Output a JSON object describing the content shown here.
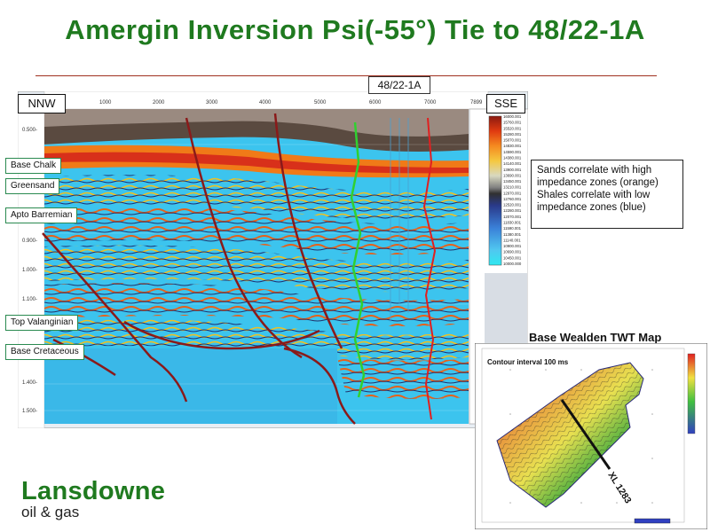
{
  "slide": {
    "title": "Amergin Inversion Psi(-55°) Tie to 48/22-1A",
    "well_label": "48/22-1A",
    "direction_left": "NNW",
    "direction_right": "SSE"
  },
  "horizon_labels": [
    "Base Chalk",
    "Greensand",
    "Apto Barremian",
    "Top Valanginian",
    "Base Cretaceous"
  ],
  "section_axis": {
    "x_ticks": [
      "1000",
      "2000",
      "3000",
      "4000",
      "5000",
      "6000",
      "7000",
      "7899"
    ],
    "y_ticks": [
      "0.500-",
      "0.900-",
      "1.000-",
      "1.100-",
      "1.400-",
      "1.500-"
    ]
  },
  "colorbar": {
    "values": [
      "16000.001",
      "15760.001",
      "15520.001",
      "15280.001",
      "15070.001",
      "14830.001",
      "14590.001",
      "14380.001",
      "14140.001",
      "13900.001",
      "13690.001",
      "13450.001",
      "13210.001",
      "12970.001",
      "12760.001",
      "12520.001",
      "12280.001",
      "12070.001",
      "11830.001",
      "11590.001",
      "11380.001",
      "11140.001",
      "10900.001",
      "10690.001",
      "10450.001",
      "10000.000"
    ],
    "colors": [
      "#8a1a10",
      "#d42a10",
      "#f26018",
      "#f79020",
      "#f7c040",
      "#f2e060",
      "#d8d8c0",
      "#a0a0a0",
      "#404040",
      "#2a3a8a",
      "#3a70d0",
      "#60b0f0",
      "#30e0f0"
    ]
  },
  "legend_text": [
    "Sands correlate with high",
    "impedance zones (orange)",
    "Shales correlate with low",
    "impedance zones (blue)"
  ],
  "map": {
    "title": "Base Wealden TWT Map",
    "contour_note": "Contour interval 100 ms",
    "line_label": "XL 1283"
  },
  "logo": {
    "name": "Lansdowne",
    "sub": "oil & gas"
  },
  "colors": {
    "title_green": "#1f7a1f",
    "fault_red": "#8a1a1a",
    "shale_blue": "#38c8f0",
    "sand_orange": "#f07a18"
  }
}
